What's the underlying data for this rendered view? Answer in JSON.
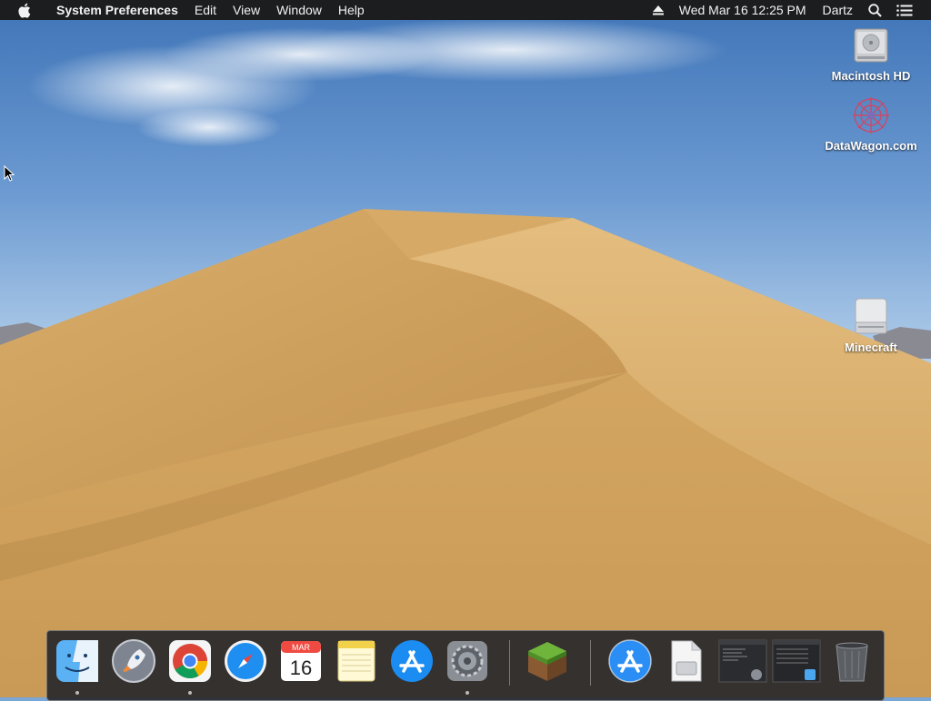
{
  "menubar": {
    "app_name": "System Preferences",
    "menus": [
      "Edit",
      "View",
      "Window",
      "Help"
    ],
    "datetime": "Wed Mar 16  12:25 PM",
    "user": "Dartz"
  },
  "desktop_icons": [
    {
      "label": "Macintosh HD",
      "icon": "hard-drive-icon"
    },
    {
      "label": "DataWagon.com",
      "icon": "datawagon-icon"
    },
    {
      "label": "Minecraft",
      "icon": "external-drive-icon"
    }
  ],
  "dock": {
    "calendar_month": "MAR",
    "calendar_day": "16",
    "apps": [
      "finder-icon",
      "launchpad-icon",
      "chrome-icon",
      "safari-icon",
      "calendar-icon",
      "notes-icon",
      "app-store-icon",
      "system-preferences-icon",
      "minecraft-icon",
      "app-store-downloads-icon",
      "document-icon",
      "window-thumbnail-icon",
      "window-thumbnail-icon",
      "trash-icon"
    ],
    "running_indicators": [
      "finder",
      "chrome",
      "system-preferences"
    ]
  },
  "colors": {
    "menubar_bg": "#1c1d1f",
    "dock_bg": "#28282a",
    "sand": "#d2a55f",
    "sky": "#6d9bd2"
  }
}
